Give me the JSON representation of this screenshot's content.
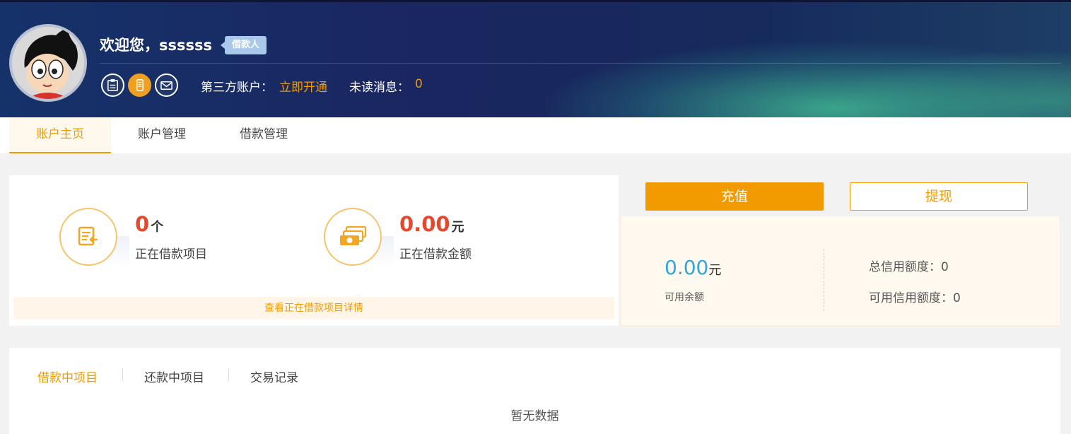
{
  "header": {
    "greeting": "欢迎您，ssssss",
    "role_badge": "借款人",
    "third_party_label": "第三方账户：",
    "third_party_link": "立即开通",
    "unread_label": "未读消息：",
    "unread_count": "0",
    "verify_icons": [
      "id-card-icon",
      "phone-icon",
      "email-icon"
    ]
  },
  "tabs": [
    {
      "label": "账户主页",
      "active": true
    },
    {
      "label": "账户管理",
      "active": false
    },
    {
      "label": "借款管理",
      "active": false
    }
  ],
  "stats": {
    "projects_value": "0",
    "projects_unit": "个",
    "projects_label": "正在借款项目",
    "amount_value": "0.00",
    "amount_unit": "元",
    "amount_label": "正在借款金额",
    "detail_link": "查看正在借款项目详情"
  },
  "balance": {
    "recharge_label": "充值",
    "withdraw_label": "提现",
    "available_value": "0.00",
    "available_unit": "元",
    "available_label": "可用余额",
    "total_credit": "总信用额度：0",
    "available_credit": "可用信用额度：0"
  },
  "records": {
    "tabs": [
      "借款中项目",
      "还款中项目",
      "交易记录"
    ],
    "empty_text": "暂无数据"
  },
  "colors": {
    "accent": "#f29b00",
    "value_red": "#e24a30",
    "balance_blue": "#2ea7e0"
  }
}
